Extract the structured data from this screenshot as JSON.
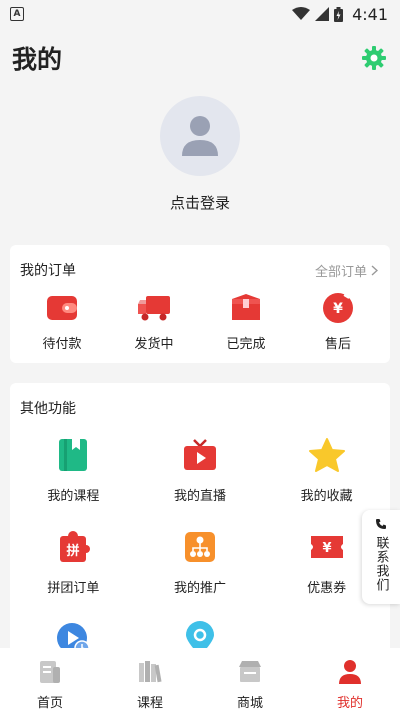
{
  "status": {
    "time": "4:41",
    "notification_letter": "A"
  },
  "header": {
    "title": "我的"
  },
  "profile": {
    "login_text": "点击登录"
  },
  "orders": {
    "title": "我的订单",
    "more": "全部订单",
    "items": [
      {
        "label": "待付款",
        "icon": "wallet-icon"
      },
      {
        "label": "发货中",
        "icon": "truck-icon"
      },
      {
        "label": "已完成",
        "icon": "box-icon"
      },
      {
        "label": "售后",
        "icon": "yen-refresh-icon"
      }
    ]
  },
  "others": {
    "title": "其他功能",
    "items": [
      {
        "label": "我的课程",
        "icon": "book-icon"
      },
      {
        "label": "我的直播",
        "icon": "tv-play-icon"
      },
      {
        "label": "我的收藏",
        "icon": "star-icon"
      },
      {
        "label": "拼团订单",
        "icon": "group-buy-icon"
      },
      {
        "label": "我的推广",
        "icon": "share-network-icon"
      },
      {
        "label": "优惠券",
        "icon": "coupon-icon"
      },
      {
        "label": "",
        "icon": "play-history-icon"
      },
      {
        "label": "",
        "icon": "location-pin-icon"
      }
    ]
  },
  "contact": {
    "label": "联系我们"
  },
  "tabbar": {
    "items": [
      {
        "label": "首页",
        "active": false
      },
      {
        "label": "课程",
        "active": false
      },
      {
        "label": "商城",
        "active": false
      },
      {
        "label": "我的",
        "active": true
      }
    ]
  },
  "colors": {
    "accent": "#e0302c",
    "gear": "#2ecc71",
    "inactive_icon": "#c8c8c8",
    "background": "#f4f4f4"
  }
}
